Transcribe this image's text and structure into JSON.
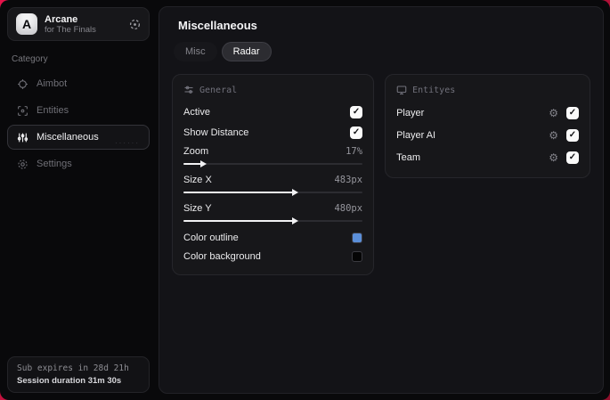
{
  "sidebar": {
    "header": {
      "logo_letter": "A",
      "title": "Arcane",
      "subtitle": "for The Finals"
    },
    "category_label": "Category",
    "items": [
      {
        "label": "Aimbot",
        "icon": "crosshair-icon",
        "selected": false
      },
      {
        "label": "Entities",
        "icon": "scan-eye-icon",
        "selected": false
      },
      {
        "label": "Miscellaneous",
        "icon": "sliders-icon",
        "selected": true
      },
      {
        "label": "Settings",
        "icon": "gear-icon",
        "selected": false
      }
    ],
    "selected_item_dots": "······",
    "footer": {
      "line1": "Sub expires in 28d 21h",
      "line2": "Session duration 31m 30s"
    }
  },
  "main": {
    "title": "Miscellaneous",
    "tabs": [
      {
        "label": "Misc",
        "active": false
      },
      {
        "label": "Radar",
        "active": true
      }
    ],
    "general": {
      "title": "General",
      "checkbox_rows": [
        {
          "label": "Active",
          "checked": true
        },
        {
          "label": "Show Distance",
          "checked": true
        }
      ],
      "slider_rows": [
        {
          "label": "Zoom",
          "value": "17%",
          "fill_pct": 10
        },
        {
          "label": "Size X",
          "value": "483px",
          "fill_pct": 61
        },
        {
          "label": "Size Y",
          "value": "480px",
          "fill_pct": 61
        }
      ],
      "color_rows": [
        {
          "label": "Color outline",
          "color": "#5b8fd9"
        },
        {
          "label": "Color background",
          "color": "#050505"
        }
      ]
    },
    "entities": {
      "title": "Entityes",
      "rows": [
        {
          "label": "Player",
          "checked": true
        },
        {
          "label": "Player AI",
          "checked": true
        },
        {
          "label": "Team",
          "checked": true
        }
      ]
    }
  },
  "glyphs": {
    "check": "✓",
    "gear": "⚙"
  },
  "colors": {
    "desktop_accent": "#d21a3e",
    "outline_swatch": "#5b8fd9",
    "background_swatch": "#050505"
  }
}
